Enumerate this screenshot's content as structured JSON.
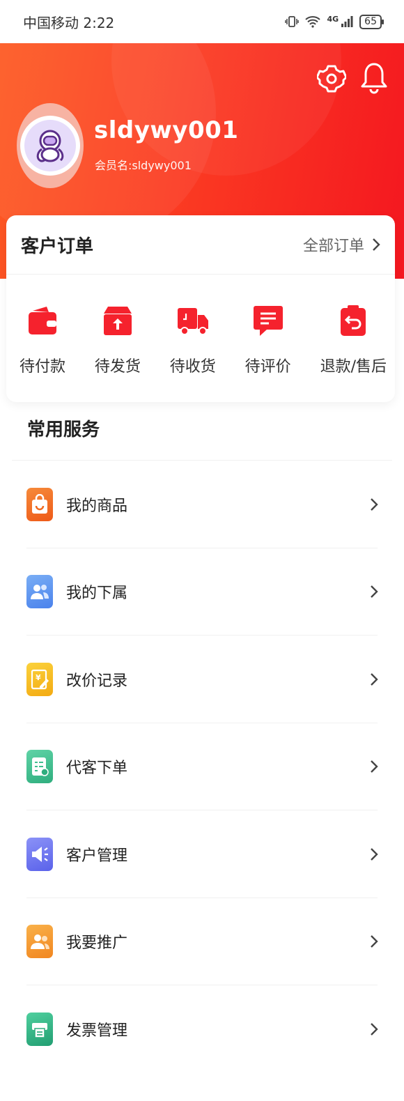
{
  "status_bar": {
    "carrier_time": "中国移动 2:22",
    "network": "4G",
    "battery": "65"
  },
  "header": {
    "username": "sldywy001",
    "member_name": "会员名:sldywy001"
  },
  "orders": {
    "title": "客户订单",
    "all_label": "全部订单",
    "items": [
      {
        "label": "待付款",
        "icon": "wallet-icon"
      },
      {
        "label": "待发货",
        "icon": "box-upload-icon"
      },
      {
        "label": "待收货",
        "icon": "delivery-truck-icon"
      },
      {
        "label": "待评价",
        "icon": "comment-icon"
      },
      {
        "label": "退款/售后",
        "icon": "refund-icon"
      }
    ]
  },
  "services": {
    "title": "常用服务",
    "items": [
      {
        "label": "我的商品",
        "icon": "shopping-bag-icon",
        "color": "#f06b21"
      },
      {
        "label": "我的下属",
        "icon": "subordinates-icon",
        "color": "#4f8ff0"
      },
      {
        "label": "改价记录",
        "icon": "price-edit-icon",
        "color": "#f7c021"
      },
      {
        "label": "代客下单",
        "icon": "order-list-icon",
        "color": "#3fbf8f"
      },
      {
        "label": "客户管理",
        "icon": "megaphone-icon",
        "color": "#6a72f2"
      },
      {
        "label": "我要推广",
        "icon": "promote-users-icon",
        "color": "#f49a2b"
      },
      {
        "label": "发票管理",
        "icon": "invoice-printer-icon",
        "color": "#33b68a"
      }
    ]
  },
  "colors": {
    "brand_red": "#f5222d",
    "header_gradient_start": "#fd5a23",
    "header_gradient_end": "#f41720"
  }
}
